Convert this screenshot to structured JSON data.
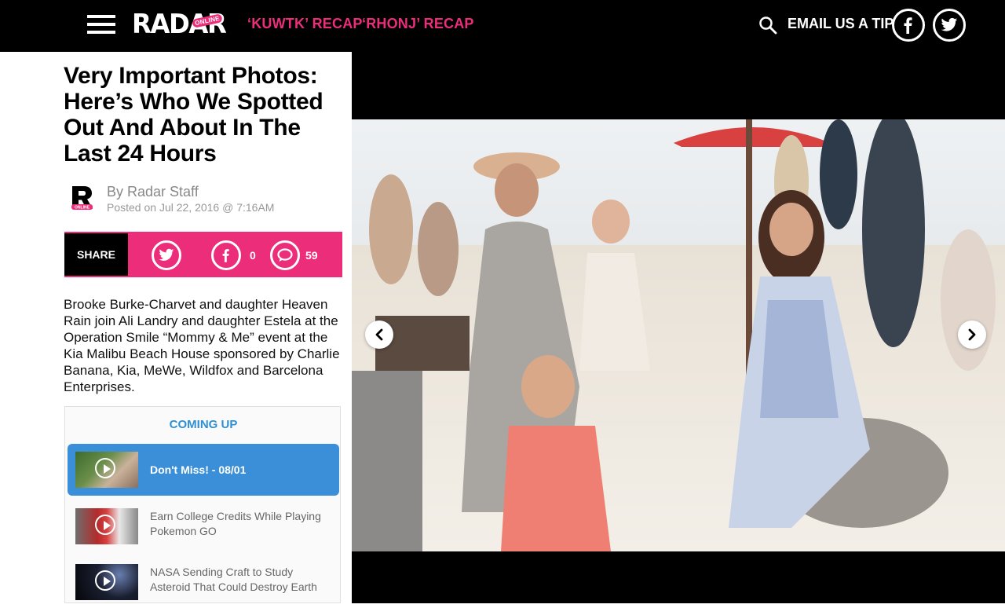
{
  "header": {
    "logo_text": "RADAR",
    "logo_badge": "ONLINE",
    "nav": [
      {
        "label": "‘KUWTK’ RECAP"
      },
      {
        "label": "‘RHONJ’ RECAP"
      }
    ],
    "tip_label": "EMAIL US A TIP",
    "social": [
      "facebook-icon",
      "twitter-icon"
    ],
    "accent_color": "#ec2e7a"
  },
  "article": {
    "title": "Very Important Photos: Here’s Who We Spotted Out And About In The Last 24 Hours",
    "byline": "By Radar Staff",
    "posted": "Posted on Jul 22, 2016 @ 7:16AM",
    "share": {
      "label": "SHARE",
      "facebook_count": "0",
      "comments_count": "59"
    },
    "caption": "Brooke Burke-Charvet and daughter Heaven Rain join Ali Landry and daughter Estela at the Operation Smile “Mommy & Me” event at the Kia Malibu Beach House sponsored by Charlie Banana, Kia, MeWe, Wildfox and Barcelona Enterprises."
  },
  "coming_up": {
    "title": "COMING UP",
    "title_color": "#2d8fd6",
    "items": [
      {
        "title": "Don't Miss! - 08/01",
        "active": true
      },
      {
        "title": "Earn College Credits While Playing Pokemon GO",
        "active": false
      },
      {
        "title": "NASA Sending Craft to Study Asteroid That Could Destroy Earth",
        "active": false
      }
    ]
  },
  "slideshow": {
    "prev_icon": "chevron-left-icon",
    "next_icon": "chevron-right-icon"
  }
}
